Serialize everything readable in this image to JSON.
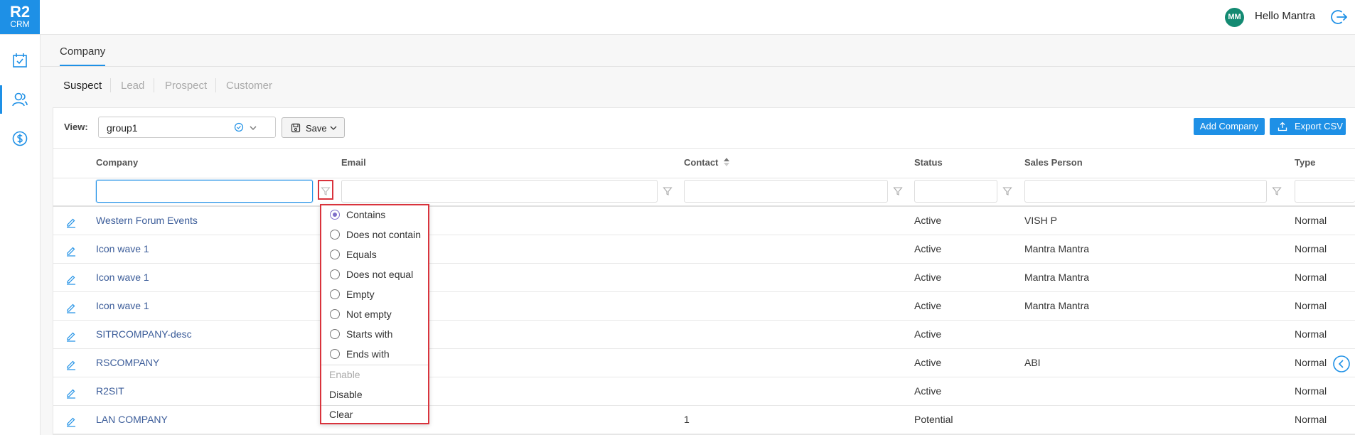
{
  "app": {
    "logo_line1": "R2",
    "logo_line2": "CRM"
  },
  "header": {
    "avatar_initials": "MM",
    "greeting": "Hello Mantra"
  },
  "page": {
    "title": "Company",
    "subtabs": [
      "Suspect",
      "Lead",
      "Prospect",
      "Customer"
    ]
  },
  "toolbar": {
    "view_label": "View:",
    "view_value": "group1",
    "save_label": "Save",
    "add_company_label": "Add Company",
    "export_csv_label": "Export CSV"
  },
  "table": {
    "columns": [
      "Company",
      "Email",
      "Contact",
      "Status",
      "Sales Person",
      "Type"
    ],
    "sorted_column": "Contact",
    "rows": [
      {
        "company": "Western Forum Events",
        "contact": "",
        "status": "Active",
        "sales_person": "VISH P",
        "type": "Normal"
      },
      {
        "company": "Icon wave 1",
        "contact": "",
        "status": "Active",
        "sales_person": "Mantra Mantra",
        "type": "Normal"
      },
      {
        "company": "Icon wave 1",
        "contact": "",
        "status": "Active",
        "sales_person": "Mantra Mantra",
        "type": "Normal"
      },
      {
        "company": "Icon wave 1",
        "contact": "",
        "status": "Active",
        "sales_person": "Mantra Mantra",
        "type": "Normal"
      },
      {
        "company": "SITRCOMPANY-desc",
        "contact": "",
        "status": "Active",
        "sales_person": "",
        "type": "Normal"
      },
      {
        "company": "RSCOMPANY",
        "contact": "",
        "status": "Active",
        "sales_person": "ABI",
        "type": "Normal"
      },
      {
        "company": "R2SIT",
        "contact": "",
        "status": "Active",
        "sales_person": "",
        "type": "Normal"
      },
      {
        "company": "LAN COMPANY",
        "contact": "1",
        "status": "Potential",
        "sales_person": "",
        "type": "Normal"
      }
    ]
  },
  "filter_menu": {
    "options": [
      "Contains",
      "Does not contain",
      "Equals",
      "Does not equal",
      "Empty",
      "Not empty",
      "Starts with",
      "Ends with"
    ],
    "selected": "Contains",
    "enable_label": "Enable",
    "disable_label": "Disable",
    "clear_label": "Clear"
  },
  "colors": {
    "accent": "#1e90e6",
    "highlight": "#d9333c",
    "avatar": "#138a72"
  },
  "icons": [
    "calendar-check-icon",
    "users-icon",
    "dollar-icon",
    "logout-icon",
    "filter-icon",
    "edit-icon",
    "save-icon",
    "export-icon",
    "check-circle-icon",
    "chevron-down-icon",
    "sort-asc-icon",
    "chevron-left-icon"
  ]
}
